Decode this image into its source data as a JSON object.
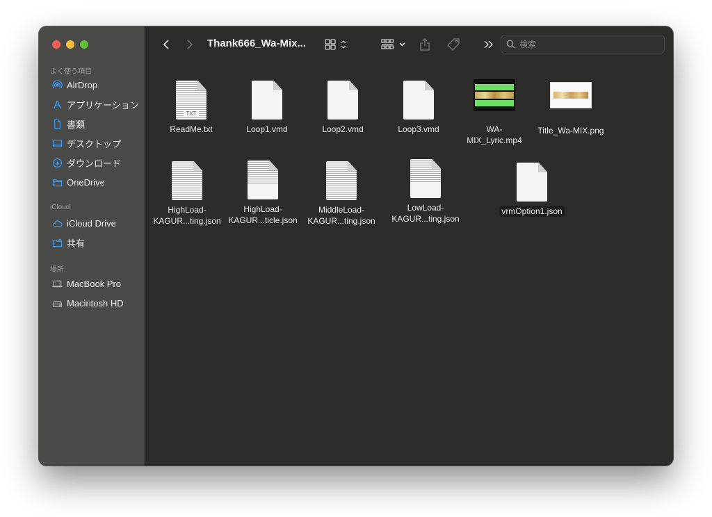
{
  "window": {
    "title": "Thank666_Wa-Mix...",
    "search_placeholder": "検索"
  },
  "sidebar": {
    "sections": [
      {
        "title": "よく使う項目",
        "items": [
          {
            "label": "AirDrop",
            "icon": "airdrop-icon"
          },
          {
            "label": "アプリケーション",
            "icon": "applications-icon"
          },
          {
            "label": "書類",
            "icon": "document-icon"
          },
          {
            "label": "デスクトップ",
            "icon": "desktop-icon"
          },
          {
            "label": "ダウンロード",
            "icon": "download-icon"
          },
          {
            "label": "OneDrive",
            "icon": "folder-icon"
          }
        ]
      },
      {
        "title": "iCloud",
        "items": [
          {
            "label": "iCloud Drive",
            "icon": "cloud-icon"
          },
          {
            "label": "共有",
            "icon": "shared-folder-icon"
          }
        ]
      },
      {
        "title": "場所",
        "items": [
          {
            "label": "MacBook Pro",
            "icon": "laptop-icon"
          },
          {
            "label": "Macintosh HD",
            "icon": "disk-icon"
          }
        ]
      }
    ]
  },
  "files": [
    {
      "name": "ReadMe.txt",
      "kind": "text",
      "tag": "TXT"
    },
    {
      "name": "Loop1.vmd",
      "kind": "blank"
    },
    {
      "name": "Loop2.vmd",
      "kind": "blank"
    },
    {
      "name": "Loop3.vmd",
      "kind": "blank"
    },
    {
      "name": "WA-\nMIX_Lyric.mp4",
      "kind": "video"
    },
    {
      "name": "Title_Wa-MIX.png",
      "kind": "image"
    },
    {
      "name": "HighLoad-\nKAGUR...ting.json",
      "kind": "lines"
    },
    {
      "name": "HighLoad-\nKAGUR...ticle.json",
      "kind": "lines-half"
    },
    {
      "name": "MiddleLoad-\nKAGUR...ting.json",
      "kind": "lines"
    },
    {
      "name": "LowLoad-\nKAGUR...ting.json",
      "kind": "lines-half"
    },
    {
      "name": "vrmOption1.json",
      "kind": "blank",
      "selected_label": true
    }
  ],
  "colors": {
    "accent": "#3b82f6",
    "window_bg": "#2c2c2a",
    "sidebar_bg": "#4a4a48"
  }
}
